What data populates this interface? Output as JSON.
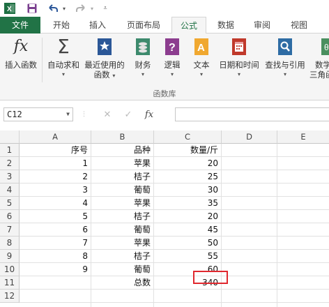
{
  "quick_access": {
    "excel_icon": "excel-logo-icon",
    "save_icon": "save-icon",
    "undo_icon": "undo-icon",
    "redo_icon": "redo-icon",
    "customize_icon": "customize-qat-icon"
  },
  "tabs": [
    {
      "label": "文件",
      "state": "file"
    },
    {
      "label": "开始",
      "state": "normal"
    },
    {
      "label": "插入",
      "state": "normal"
    },
    {
      "label": "页面布局",
      "state": "normal"
    },
    {
      "label": "公式",
      "state": "active"
    },
    {
      "label": "数据",
      "state": "normal"
    },
    {
      "label": "审阅",
      "state": "normal"
    },
    {
      "label": "视图",
      "state": "normal"
    }
  ],
  "ribbon": {
    "insert_function": "插入函数",
    "autosum": "自动求和",
    "recent_line1": "最近使用的",
    "recent_line2": "函数",
    "financial": "财务",
    "logical": "逻辑",
    "text": "文本",
    "datetime": "日期和时间",
    "lookup": "查找与引用",
    "math_line1": "数学",
    "math_line2": "三角函",
    "group_label": "函数库"
  },
  "formula_bar": {
    "name_box": "C12",
    "cancel": "✕",
    "enter": "✓",
    "fx": "fx",
    "content": ""
  },
  "colors": {
    "accent": "#217346",
    "selection": "#e0282e"
  },
  "columns": [
    "A",
    "B",
    "C",
    "D",
    "E"
  ],
  "rows": [
    "1",
    "2",
    "3",
    "4",
    "5",
    "6",
    "7",
    "8",
    "9",
    "10",
    "11",
    "12"
  ],
  "cells": {
    "header": {
      "a": "序号",
      "b": "品种",
      "c": "数量/斤"
    },
    "data": [
      {
        "a": "1",
        "b": "苹果",
        "c": "20"
      },
      {
        "a": "2",
        "b": "桔子",
        "c": "25"
      },
      {
        "a": "3",
        "b": "葡萄",
        "c": "30"
      },
      {
        "a": "4",
        "b": "苹果",
        "c": "35"
      },
      {
        "a": "5",
        "b": "桔子",
        "c": "20"
      },
      {
        "a": "6",
        "b": "葡萄",
        "c": "45"
      },
      {
        "a": "7",
        "b": "苹果",
        "c": "50"
      },
      {
        "a": "8",
        "b": "桔子",
        "c": "55"
      },
      {
        "a": "9",
        "b": "葡萄",
        "c": "60"
      }
    ],
    "total": {
      "label": "总数",
      "value": "340"
    }
  }
}
